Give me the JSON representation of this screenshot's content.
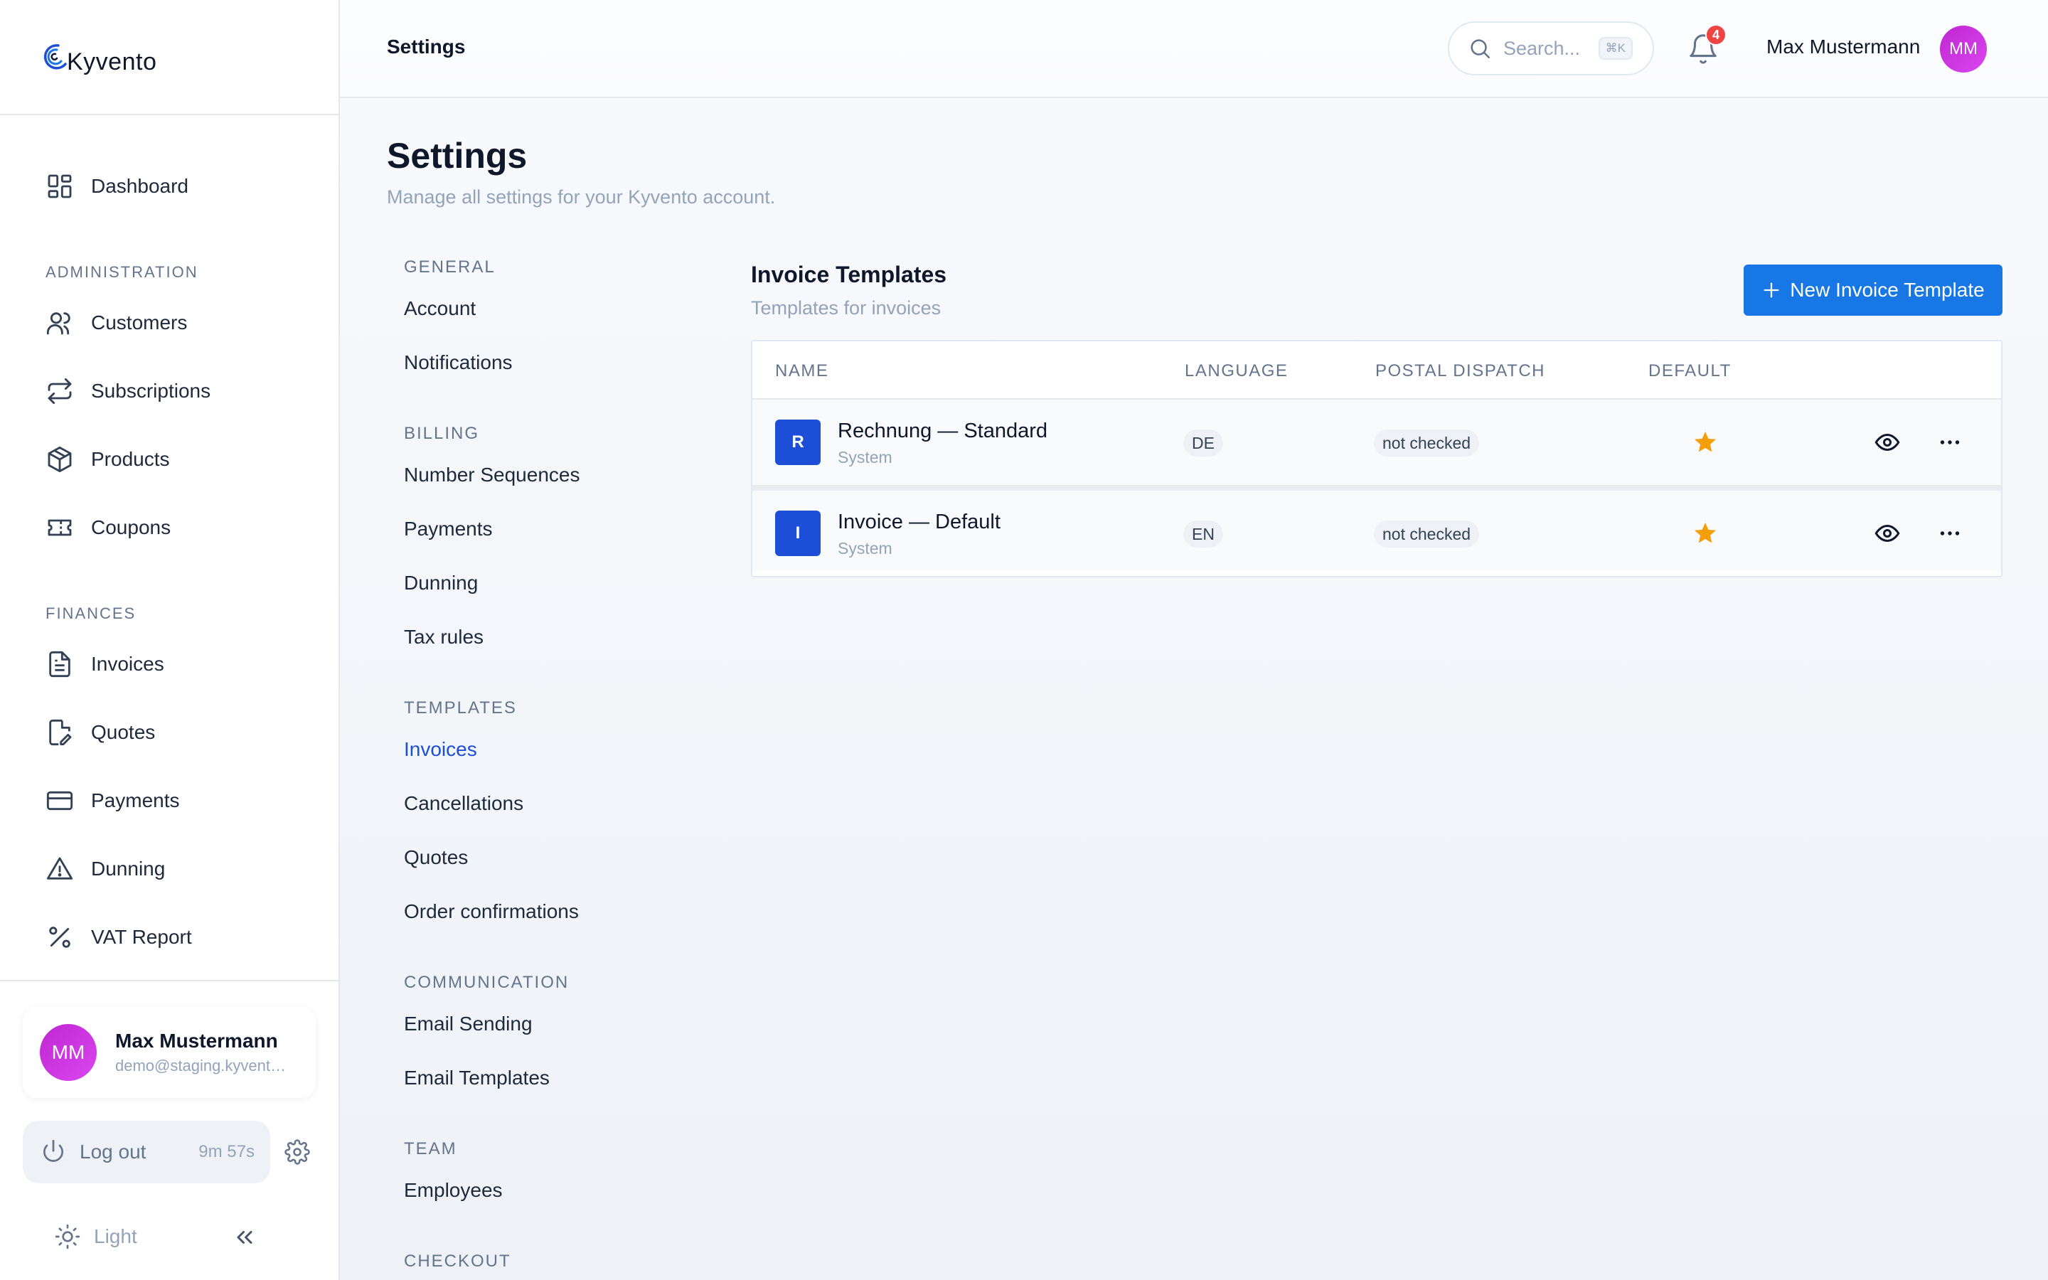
{
  "app": {
    "name": "Kyvento"
  },
  "sidebar": {
    "items_top": [
      {
        "label": "Dashboard",
        "icon": "dashboard-icon"
      }
    ],
    "sections": [
      {
        "title": "ADMINISTRATION",
        "items": [
          {
            "label": "Customers",
            "icon": "users-icon"
          },
          {
            "label": "Subscriptions",
            "icon": "repeat-icon"
          },
          {
            "label": "Products",
            "icon": "box-icon"
          },
          {
            "label": "Coupons",
            "icon": "ticket-icon"
          }
        ]
      },
      {
        "title": "FINANCES",
        "items": [
          {
            "label": "Invoices",
            "icon": "file-text-icon"
          },
          {
            "label": "Quotes",
            "icon": "file-edit-icon"
          },
          {
            "label": "Payments",
            "icon": "credit-card-icon"
          },
          {
            "label": "Dunning",
            "icon": "warning-icon"
          },
          {
            "label": "VAT Report",
            "icon": "percent-icon"
          }
        ]
      }
    ],
    "user": {
      "initials": "MM",
      "name": "Max Mustermann",
      "email": "demo@staging.kyvento.de"
    },
    "logout_label": "Log out",
    "session_timer": "9m 57s",
    "theme_label": "Light"
  },
  "topbar": {
    "title": "Settings",
    "search_placeholder": "Search...",
    "search_shortcut": "⌘K",
    "notification_count": "4",
    "user_name": "Max Mustermann",
    "user_initials": "MM"
  },
  "page": {
    "title": "Settings",
    "subtitle": "Manage all settings for your Kyvento account."
  },
  "settings_nav": {
    "sections": [
      {
        "title": "GENERAL",
        "items": [
          "Account",
          "Notifications"
        ]
      },
      {
        "title": "BILLING",
        "items": [
          "Number Sequences",
          "Payments",
          "Dunning",
          "Tax rules"
        ]
      },
      {
        "title": "TEMPLATES",
        "items": [
          "Invoices",
          "Cancellations",
          "Quotes",
          "Order confirmations"
        ]
      },
      {
        "title": "COMMUNICATION",
        "items": [
          "Email Sending",
          "Email Templates"
        ]
      },
      {
        "title": "TEAM",
        "items": [
          "Employees"
        ]
      },
      {
        "title": "CHECKOUT",
        "items": []
      }
    ],
    "active": "Invoices"
  },
  "content": {
    "title": "Invoice Templates",
    "subtitle": "Templates for invoices",
    "new_button_label": "New Invoice Template",
    "table": {
      "columns": [
        "NAME",
        "LANGUAGE",
        "POSTAL DISPATCH",
        "DEFAULT"
      ],
      "rows": [
        {
          "initial": "R",
          "name": "Rechnung — Standard",
          "source": "System",
          "language": "DE",
          "postal_dispatch": "not checked",
          "is_default": true
        },
        {
          "initial": "I",
          "name": "Invoice — Default",
          "source": "System",
          "language": "EN",
          "postal_dispatch": "not checked",
          "is_default": true
        }
      ]
    }
  },
  "colors": {
    "accent": "#1677e5",
    "active_link": "#1d4ed8",
    "row_icon": "#1d4ed8",
    "star": "#f59e0b",
    "badge": "#ef4444",
    "avatar": "#c026d3"
  }
}
